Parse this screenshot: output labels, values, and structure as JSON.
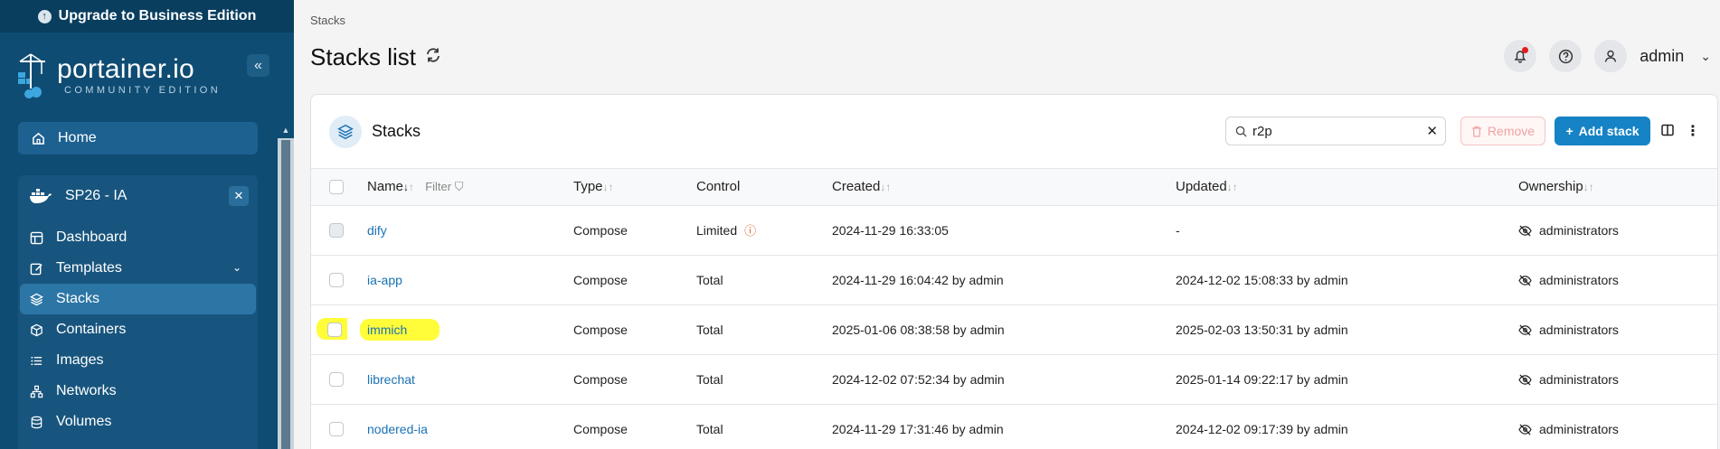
{
  "sidebar": {
    "upgrade_label": "Upgrade to Business Edition",
    "logo_text": "portainer.io",
    "logo_sub": "COMMUNITY EDITION",
    "collapse_glyph": "«",
    "home_label": "Home",
    "environment": {
      "name": "SP26 - IA",
      "close_glyph": "✕"
    },
    "nav": [
      {
        "label": "Dashboard",
        "icon": "dashboard-icon"
      },
      {
        "label": "Templates",
        "icon": "templates-icon"
      },
      {
        "label": "Stacks",
        "icon": "stacks-icon"
      },
      {
        "label": "Containers",
        "icon": "containers-icon"
      },
      {
        "label": "Images",
        "icon": "images-icon"
      },
      {
        "label": "Networks",
        "icon": "networks-icon"
      },
      {
        "label": "Volumes",
        "icon": "volumes-icon"
      }
    ]
  },
  "header": {
    "breadcrumb": "Stacks",
    "title": "Stacks list",
    "user": "admin"
  },
  "card": {
    "title": "Stacks",
    "search_value": "r2p",
    "remove_label": "Remove",
    "add_label": "Add stack"
  },
  "table": {
    "headers": {
      "name": "Name",
      "filter": "Filter",
      "type": "Type",
      "control": "Control",
      "created": "Created",
      "updated": "Updated",
      "ownership": "Ownership"
    },
    "rows": [
      {
        "name": "dify",
        "type": "Compose",
        "control": "Limited",
        "created": "2024-11-29 16:33:05",
        "updated": "-",
        "ownership": "administrators"
      },
      {
        "name": "ia-app",
        "type": "Compose",
        "control": "Total",
        "created": "2024-11-29 16:04:42 by admin",
        "updated": "2024-12-02 15:08:33 by admin",
        "ownership": "administrators"
      },
      {
        "name": "immich",
        "type": "Compose",
        "control": "Total",
        "created": "2025-01-06 08:38:58 by admin",
        "updated": "2025-02-03 13:50:31 by admin",
        "ownership": "administrators"
      },
      {
        "name": "librechat",
        "type": "Compose",
        "control": "Total",
        "created": "2024-12-02 07:52:34 by admin",
        "updated": "2025-01-14 09:22:17 by admin",
        "ownership": "administrators"
      },
      {
        "name": "nodered-ia",
        "type": "Compose",
        "control": "Total",
        "created": "2024-11-29 17:31:46 by admin",
        "updated": "2024-12-02 09:17:39 by admin",
        "ownership": "administrators"
      }
    ]
  },
  "colors": {
    "sidebar": "#0f4c73",
    "accent": "#1583c5",
    "highlight": "#fffc3a"
  }
}
